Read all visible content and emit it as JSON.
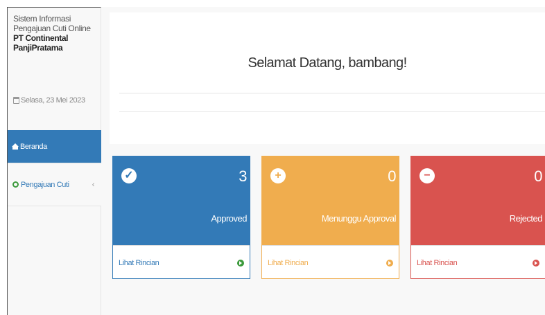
{
  "sidebar": {
    "app_name": "Sistem Informasi Pengajuan Cuti Online",
    "company": "PT Continental PanjiPratama",
    "date": "Selasa, 23 Mei 2023",
    "items": [
      {
        "label": "Beranda",
        "icon": "home-icon",
        "active": true
      },
      {
        "label": "Pengajuan Cuti",
        "icon": "recycle-icon",
        "chevron": "‹"
      }
    ]
  },
  "welcome": {
    "title": "Selamat Datang, bambang!"
  },
  "panels": [
    {
      "count": "3",
      "label": "Approved",
      "link": "Lihat Rincian",
      "icon": "check-circle-icon",
      "color": "#337ab7"
    },
    {
      "count": "0",
      "label": "Menunggu Approval",
      "link": "Lihat Rincian",
      "icon": "plus-circle-icon",
      "color": "#f0ad4e"
    },
    {
      "count": "0",
      "label": "Rejected",
      "link": "Lihat Rincian",
      "icon": "minus-circle-icon",
      "color": "#d9534f"
    }
  ]
}
